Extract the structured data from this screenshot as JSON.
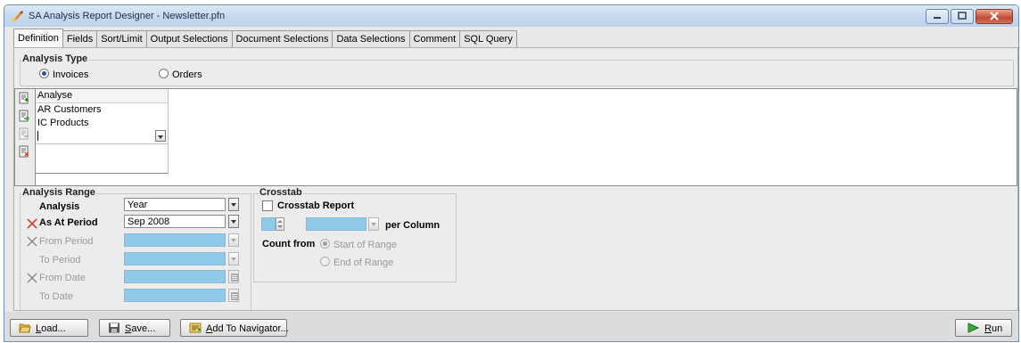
{
  "window": {
    "title": "SA Analysis Report Designer - Newsletter.pfn",
    "controls": {
      "minimize": "minimize",
      "maximize": "maximize",
      "close": "close"
    }
  },
  "tabs": [
    {
      "label": "Definition",
      "active": true
    },
    {
      "label": "Fields"
    },
    {
      "label": "Sort/Limit"
    },
    {
      "label": "Output Selections"
    },
    {
      "label": "Document Selections"
    },
    {
      "label": "Data Selections"
    },
    {
      "label": "Comment"
    },
    {
      "label": "SQL Query"
    }
  ],
  "analysis_type": {
    "legend": "Analysis Type",
    "options": [
      {
        "label": "Invoices",
        "selected": true
      },
      {
        "label": "Orders",
        "selected": false
      }
    ]
  },
  "analyse_list": {
    "header": "Analyse",
    "items": [
      "AR Customers",
      "IC Products"
    ],
    "new_item_value": ""
  },
  "analysis_range": {
    "legend": "Analysis Range",
    "rows": [
      {
        "label": "Analysis",
        "value": "Year",
        "enabled": true
      },
      {
        "label": "As At Period",
        "value": "Sep 2008",
        "enabled": true
      },
      {
        "label": "From Period",
        "value": "",
        "enabled": false
      },
      {
        "label": "To Period",
        "value": "",
        "enabled": false
      },
      {
        "label": "From Date",
        "value": "",
        "enabled": false
      },
      {
        "label": "To Date",
        "value": "",
        "enabled": false
      }
    ]
  },
  "crosstab": {
    "legend": "Crosstab",
    "report_label": "Crosstab Report",
    "report_checked": false,
    "per_column_label": "per Column",
    "count_from_label": "Count from",
    "count_options": [
      {
        "label": "Start of Range",
        "selected": true
      },
      {
        "label": "End of Range",
        "selected": false
      }
    ]
  },
  "buttons": {
    "load": "Load...",
    "save": "Save...",
    "add_to_navigator": "Add To Navigator...",
    "run": "Run"
  },
  "colors": {
    "accent_blue": "#8fcbe9",
    "delete_red": "#d83a2a",
    "titlebar": "#c6d8ee"
  }
}
